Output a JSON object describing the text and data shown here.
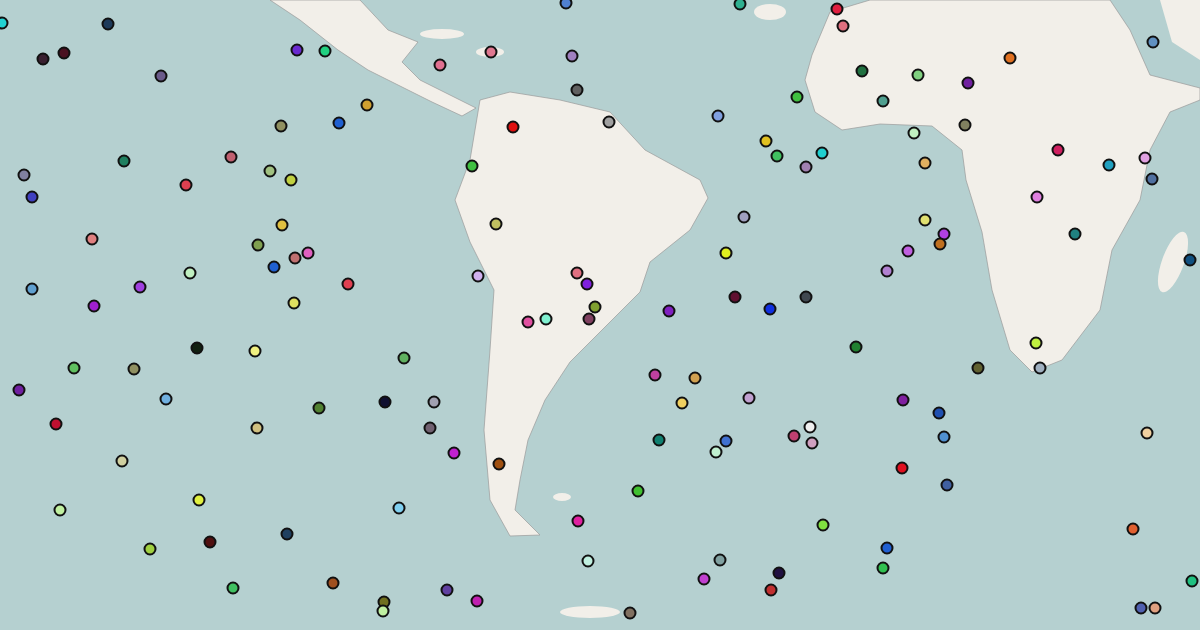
{
  "markers": [
    {
      "color": "#22d3d3"
    },
    {
      "color": "#1e3a5a"
    },
    {
      "color": "#3a2030"
    },
    {
      "color": "#4a1020"
    },
    {
      "color": "#6a5a8a"
    },
    {
      "color": "#6a2ad0"
    },
    {
      "color": "#20d080"
    },
    {
      "color": "#e07090"
    },
    {
      "color": "#e07890"
    },
    {
      "color": "#a080c0"
    },
    {
      "color": "#5080d0"
    },
    {
      "color": "#30b090"
    },
    {
      "color": "#e02040"
    },
    {
      "color": "#e07080"
    },
    {
      "color": "#d0a030"
    },
    {
      "color": "#909060"
    },
    {
      "color": "#2060d0"
    },
    {
      "color": "#606060"
    },
    {
      "color": "#e01010"
    },
    {
      "color": "#a0a0a0"
    },
    {
      "color": "#80a0e0"
    },
    {
      "color": "#40c040"
    },
    {
      "color": "#207040"
    },
    {
      "color": "#80d080"
    },
    {
      "color": "#7020a0"
    },
    {
      "color": "#e07020"
    },
    {
      "color": "#6090c0"
    },
    {
      "color": "#50a090"
    },
    {
      "color": "#c0f0c0"
    },
    {
      "color": "#808060"
    },
    {
      "color": "#e0c020"
    },
    {
      "color": "#40c060"
    },
    {
      "color": "#20d0d0"
    },
    {
      "color": "#a080b0"
    },
    {
      "color": "#e0b060"
    },
    {
      "color": "#d02060"
    },
    {
      "color": "#20a0c0"
    },
    {
      "color": "#e0a0e0"
    },
    {
      "color": "#5070a0"
    },
    {
      "color": "#208060"
    },
    {
      "color": "#c06070"
    },
    {
      "color": "#e04050"
    },
    {
      "color": "#a0c080"
    },
    {
      "color": "#c0d040"
    },
    {
      "color": "#8080a0"
    },
    {
      "color": "#4040c0"
    },
    {
      "color": "#40c041"
    },
    {
      "color": "#e0c040"
    },
    {
      "color": "#80a050"
    },
    {
      "color": "#e08080"
    },
    {
      "color": "#c0c060"
    },
    {
      "color": "#c07070"
    },
    {
      "color": "#e060c0"
    },
    {
      "color": "#2060d1"
    },
    {
      "color": "#c0f0c1"
    },
    {
      "color": "#a040e0"
    },
    {
      "color": "#60a0d0"
    },
    {
      "color": "#a020d0"
    },
    {
      "color": "#e0e060"
    },
    {
      "color": "#e04051"
    },
    {
      "color": "#d0b0f0"
    },
    {
      "color": "#e07081"
    },
    {
      "color": "#8020e0"
    },
    {
      "color": "#80a030"
    },
    {
      "color": "#e050a0"
    },
    {
      "color": "#80f0d0"
    },
    {
      "color": "#804060"
    },
    {
      "color": "#a0a0c0"
    },
    {
      "color": "#e0f020"
    },
    {
      "color": "#8020c0"
    },
    {
      "color": "#601030"
    },
    {
      "color": "#1030e0"
    },
    {
      "color": "#404850"
    },
    {
      "color": "#e0e070"
    },
    {
      "color": "#b040e0"
    },
    {
      "color": "#c07020"
    },
    {
      "color": "#c060e0"
    },
    {
      "color": "#b080d0"
    },
    {
      "color": "#e080e0"
    },
    {
      "color": "#208080"
    },
    {
      "color": "#105080"
    },
    {
      "color": "#102010"
    },
    {
      "color": "#f0f080"
    },
    {
      "color": "#60b060"
    },
    {
      "color": "#7020a1"
    },
    {
      "color": "#60c060"
    },
    {
      "color": "#909061"
    },
    {
      "color": "#70b0e0"
    },
    {
      "color": "#508030"
    },
    {
      "color": "#101030"
    },
    {
      "color": "#a0a0b0"
    },
    {
      "color": "#c01030"
    },
    {
      "color": "#d0c080"
    },
    {
      "color": "#706070"
    },
    {
      "color": "#c020d0"
    },
    {
      "color": "#d0d0a0"
    },
    {
      "color": "#a05010"
    },
    {
      "color": "#c040a0"
    },
    {
      "color": "#d0a050"
    },
    {
      "color": "#f0d060"
    },
    {
      "color": "#c0a0d0"
    },
    {
      "color": "#208030"
    },
    {
      "color": "#606030"
    },
    {
      "color": "#a0b0c0"
    },
    {
      "color": "#c0f040"
    },
    {
      "color": "#8020a0"
    },
    {
      "color": "#2050b0"
    },
    {
      "color": "#5090d0"
    },
    {
      "color": "#108070"
    },
    {
      "color": "#4070d0"
    },
    {
      "color": "#c0f0d0"
    },
    {
      "color": "#c04070"
    },
    {
      "color": "#f0f0f0"
    },
    {
      "color": "#d0a0c0"
    },
    {
      "color": "#e01020"
    },
    {
      "color": "#4060a0"
    },
    {
      "color": "#f0d0a0"
    },
    {
      "color": "#c0f0a0"
    },
    {
      "color": "#e0f040"
    },
    {
      "color": "#a0d040"
    },
    {
      "color": "#501010"
    },
    {
      "color": "#204060"
    },
    {
      "color": "#80d0f0"
    },
    {
      "color": "#e020a0"
    },
    {
      "color": "#40c030"
    },
    {
      "color": "#80e040"
    },
    {
      "color": "#2060d2"
    },
    {
      "color": "#30c050"
    },
    {
      "color": "#e06030"
    },
    {
      "color": "#c0f0e0"
    },
    {
      "color": "#80a0a0"
    },
    {
      "color": "#c040d0"
    },
    {
      "color": "#201040"
    },
    {
      "color": "#c03030"
    },
    {
      "color": "#20c080"
    },
    {
      "color": "#5060b0"
    },
    {
      "color": "#e0a080"
    },
    {
      "color": "#40c061"
    },
    {
      "color": "#a05020"
    },
    {
      "color": "#6040a0"
    },
    {
      "color": "#c020b0"
    },
    {
      "color": "#707020"
    },
    {
      "color": "#c0f0a1"
    },
    {
      "color": "#807060"
    }
  ]
}
